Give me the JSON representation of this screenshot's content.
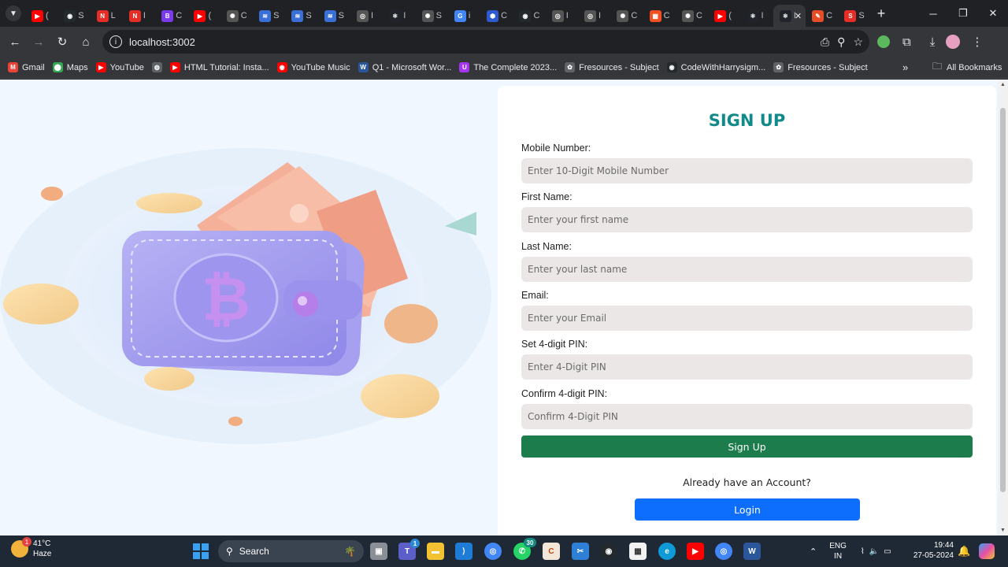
{
  "browser": {
    "tabs": [
      {
        "icon": "youtube-icon",
        "title": "(",
        "color": "#ff0000",
        "glyph": "▶"
      },
      {
        "icon": "github-icon",
        "title": "S",
        "color": "#24292e",
        "glyph": "◉"
      },
      {
        "icon": "n-icon",
        "title": "L",
        "color": "#e52d27",
        "glyph": "N"
      },
      {
        "icon": "n-icon",
        "title": "I",
        "color": "#e52d27",
        "glyph": "N"
      },
      {
        "icon": "b-icon",
        "title": "C",
        "color": "#7c3aed",
        "glyph": "B"
      },
      {
        "icon": "youtube-icon",
        "title": "(",
        "color": "#ff0000",
        "glyph": "▶"
      },
      {
        "icon": "openai-icon",
        "title": "C",
        "color": "#555",
        "glyph": "✺"
      },
      {
        "icon": "chart-icon",
        "title": "S",
        "color": "#3b6fd8",
        "glyph": "≋"
      },
      {
        "icon": "chart-icon",
        "title": "S",
        "color": "#3b6fd8",
        "glyph": "≋"
      },
      {
        "icon": "chart-icon",
        "title": "S",
        "color": "#3b6fd8",
        "glyph": "≋"
      },
      {
        "icon": "chrome-icon",
        "title": "I",
        "color": "#555",
        "glyph": "◎"
      },
      {
        "icon": "react-icon",
        "title": "I",
        "color": "#20232a",
        "glyph": "⚛"
      },
      {
        "icon": "openai-icon",
        "title": "S",
        "color": "#555",
        "glyph": "✺"
      },
      {
        "icon": "google-icon",
        "title": "i",
        "color": "#4285f4",
        "glyph": "G"
      },
      {
        "icon": "hex-icon",
        "title": "C",
        "color": "#2e5ad1",
        "glyph": "⬢"
      },
      {
        "icon": "github-icon",
        "title": "C",
        "color": "#24292e",
        "glyph": "◉"
      },
      {
        "icon": "chrome-icon",
        "title": "I",
        "color": "#555",
        "glyph": "◎"
      },
      {
        "icon": "chrome-icon",
        "title": "I",
        "color": "#555",
        "glyph": "◎"
      },
      {
        "icon": "openai-icon",
        "title": "C",
        "color": "#555",
        "glyph": "✺"
      },
      {
        "icon": "microsoft-icon",
        "title": "C",
        "color": "#f25022",
        "glyph": "▦"
      },
      {
        "icon": "openai-icon",
        "title": "C",
        "color": "#555",
        "glyph": "✺"
      },
      {
        "icon": "youtube-icon",
        "title": "(",
        "color": "#ff0000",
        "glyph": "▶"
      },
      {
        "icon": "react-icon",
        "title": "I",
        "color": "#20232a",
        "glyph": "⚛"
      },
      {
        "icon": "react-icon",
        "title": "I",
        "color": "#20232a",
        "glyph": "⚛"
      },
      {
        "icon": "html-icon",
        "title": "C",
        "color": "#e44d26",
        "glyph": "✎"
      },
      {
        "icon": "svg-png-icon",
        "title": "S",
        "color": "#e52d27",
        "glyph": "S"
      }
    ],
    "active_tab_index": 23,
    "url": "localhost:3002",
    "bookmarks": [
      {
        "label": "Gmail",
        "icon": "gmail-icon",
        "color": "#ea4335",
        "glyph": "M"
      },
      {
        "label": "Maps",
        "icon": "maps-icon",
        "color": "#34a853",
        "glyph": "⬤"
      },
      {
        "label": "YouTube",
        "icon": "youtube-icon",
        "color": "#ff0000",
        "glyph": "▶"
      },
      {
        "label": "",
        "icon": "globe-icon",
        "color": "#5f6368",
        "glyph": "◍"
      },
      {
        "label": "HTML Tutorial: Insta...",
        "icon": "youtube-icon",
        "color": "#ff0000",
        "glyph": "▶"
      },
      {
        "label": "YouTube Music",
        "icon": "youtube-music-icon",
        "color": "#ff0000",
        "glyph": "◉"
      },
      {
        "label": "Q1 - Microsoft Wor...",
        "icon": "word-icon",
        "color": "#2b579a",
        "glyph": "W"
      },
      {
        "label": "The Complete 2023...",
        "icon": "udemy-icon",
        "color": "#a435f0",
        "glyph": "U"
      },
      {
        "label": "Fresources - Subject",
        "icon": "gear-icon",
        "color": "#5f6368",
        "glyph": "✿"
      },
      {
        "label": "CodeWithHarrysigm...",
        "icon": "github-icon",
        "color": "#24292e",
        "glyph": "◉"
      },
      {
        "label": "Fresources - Subject",
        "icon": "gear-icon",
        "color": "#5f6368",
        "glyph": "✿"
      }
    ],
    "all_bookmarks_label": "All Bookmarks"
  },
  "form": {
    "title": "SIGN UP",
    "fields": [
      {
        "label": "Mobile Number:",
        "placeholder": "Enter 10-Digit Mobile Number"
      },
      {
        "label": "First Name:",
        "placeholder": "Enter your first name"
      },
      {
        "label": "Last Name:",
        "placeholder": "Enter your last name"
      },
      {
        "label": "Email:",
        "placeholder": "Enter your Email"
      },
      {
        "label": "Set 4-digit PIN:",
        "placeholder": "Enter 4-Digit PIN"
      },
      {
        "label": "Confirm 4-digit PIN:",
        "placeholder": "Confirm 4-Digit PIN"
      }
    ],
    "signup_label": "Sign Up",
    "already_text": "Already have an Account?",
    "login_label": "Login"
  },
  "taskbar": {
    "weather_temp": "41°C",
    "weather_desc": "Haze",
    "weather_badge": "1",
    "search_label": "Search",
    "lang_1": "ENG",
    "lang_2": "IN",
    "time": "19:44",
    "date": "27-05-2024",
    "teams_badge": "1",
    "whatsapp_badge": "30"
  }
}
